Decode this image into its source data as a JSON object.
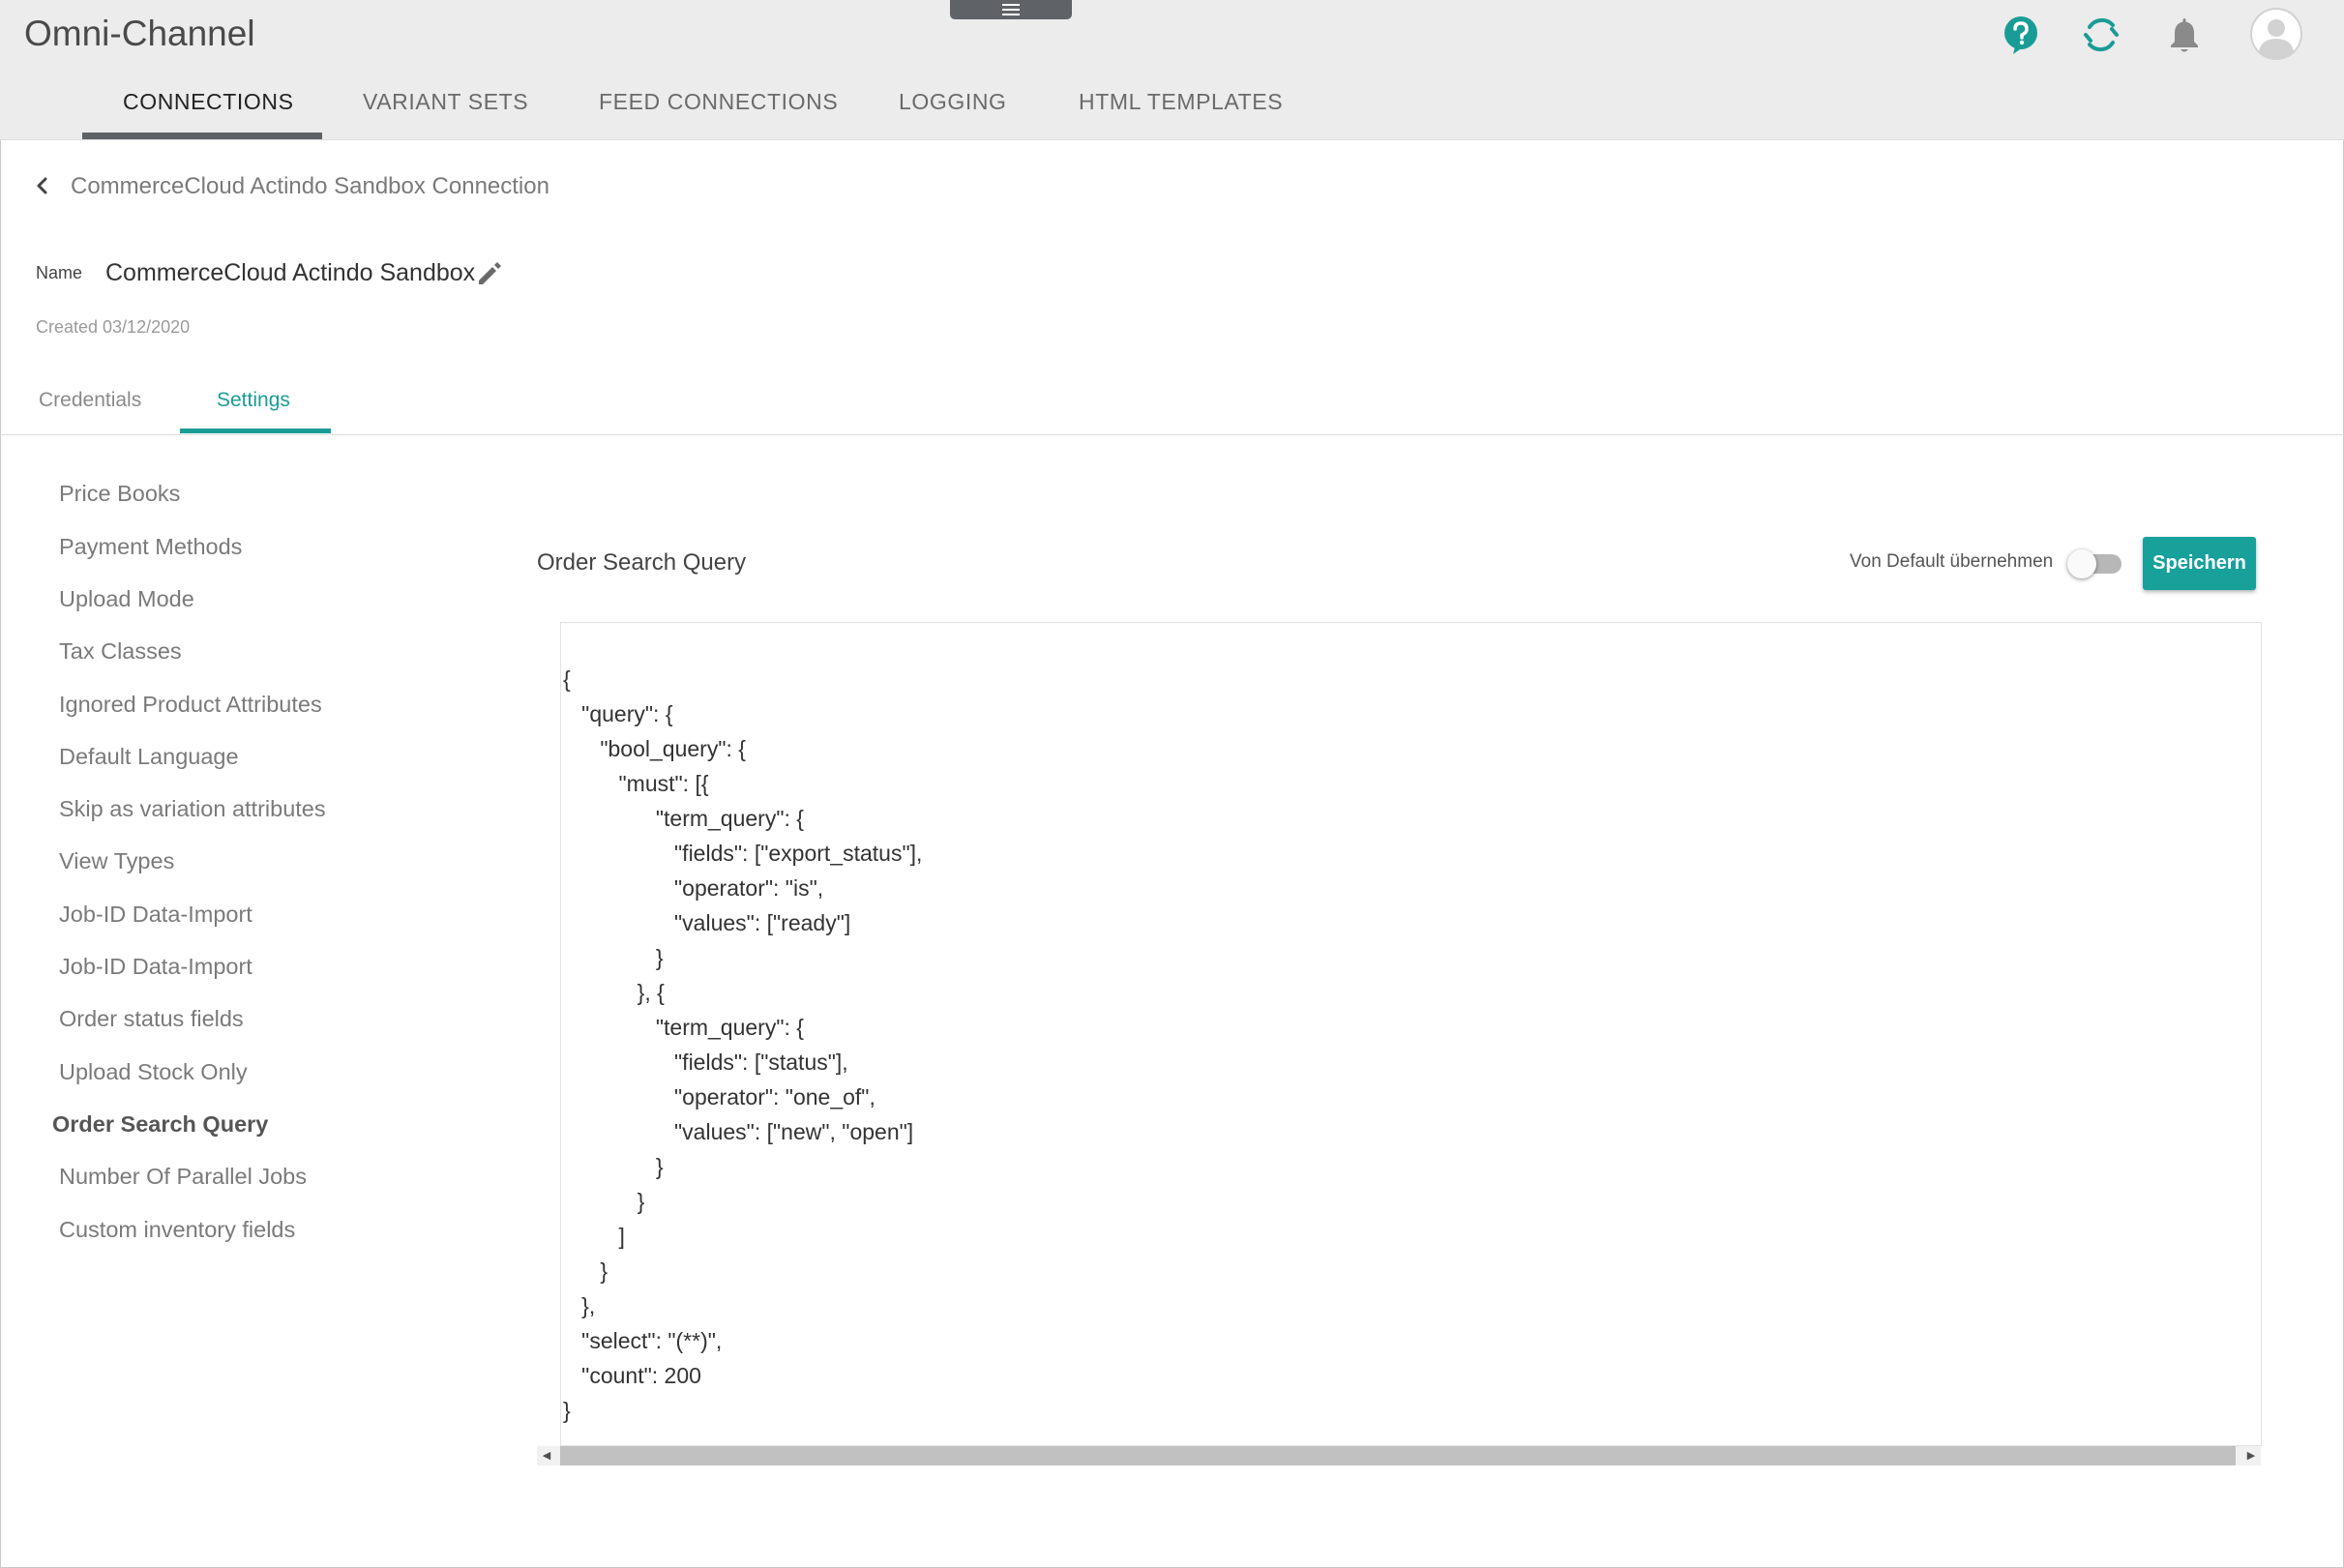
{
  "app": {
    "title": "Omni-Channel"
  },
  "header": {
    "icons": [
      "help-icon",
      "sync-icon",
      "bell-icon",
      "avatar"
    ],
    "accent_color": "#1a9c96"
  },
  "main_tabs": [
    {
      "label": "CONNECTIONS",
      "active": true
    },
    {
      "label": "VARIANT SETS",
      "active": false
    },
    {
      "label": "FEED CONNECTIONS",
      "active": false
    },
    {
      "label": "LOGGING",
      "active": false
    },
    {
      "label": "HTML TEMPLATES",
      "active": false
    }
  ],
  "breadcrumb": {
    "title": "CommerceCloud Actindo Sandbox Connection"
  },
  "detail": {
    "name_label": "Name",
    "name_value": "CommerceCloud Actindo Sandbox",
    "created": "Created 03/12/2020"
  },
  "sub_tabs": [
    {
      "label": "Credentials",
      "active": false
    },
    {
      "label": "Settings",
      "active": true
    }
  ],
  "settings_menu": [
    {
      "label": "Price Books",
      "active": false
    },
    {
      "label": "Payment Methods",
      "active": false
    },
    {
      "label": "Upload Mode",
      "active": false
    },
    {
      "label": "Tax Classes",
      "active": false
    },
    {
      "label": "Ignored Product Attributes",
      "active": false
    },
    {
      "label": "Default Language",
      "active": false
    },
    {
      "label": "Skip as variation attributes",
      "active": false
    },
    {
      "label": "View Types",
      "active": false
    },
    {
      "label": "Job-ID Data-Import",
      "active": false
    },
    {
      "label": "Job-ID Data-Import",
      "active": false
    },
    {
      "label": "Order status fields",
      "active": false
    },
    {
      "label": "Upload Stock Only",
      "active": false
    },
    {
      "label": "Order Search Query",
      "active": true
    },
    {
      "label": "Number Of Parallel Jobs",
      "active": false
    },
    {
      "label": "Custom inventory fields",
      "active": false
    }
  ],
  "content": {
    "section_title": "Order Search Query",
    "toggle_label": "Von Default übernehmen",
    "toggle_on": false,
    "save_label": "Speichern",
    "code_lines": [
      "{",
      "   \"query\": {",
      "      \"bool_query\": {",
      "         \"must\": [{",
      "               \"term_query\": {",
      "                  \"fields\": [\"export_status\"],",
      "                  \"operator\": \"is\",",
      "                  \"values\": [\"ready\"]",
      "               }",
      "            }, {",
      "               \"term_query\": {",
      "                  \"fields\": [\"status\"],",
      "                  \"operator\": \"one_of\",",
      "                  \"values\": [\"new\", \"open\"]",
      "               }",
      "            }",
      "         ]",
      "      }",
      "   },",
      "   \"select\": \"(**)\",",
      "   \"count\": 200",
      "}"
    ]
  }
}
